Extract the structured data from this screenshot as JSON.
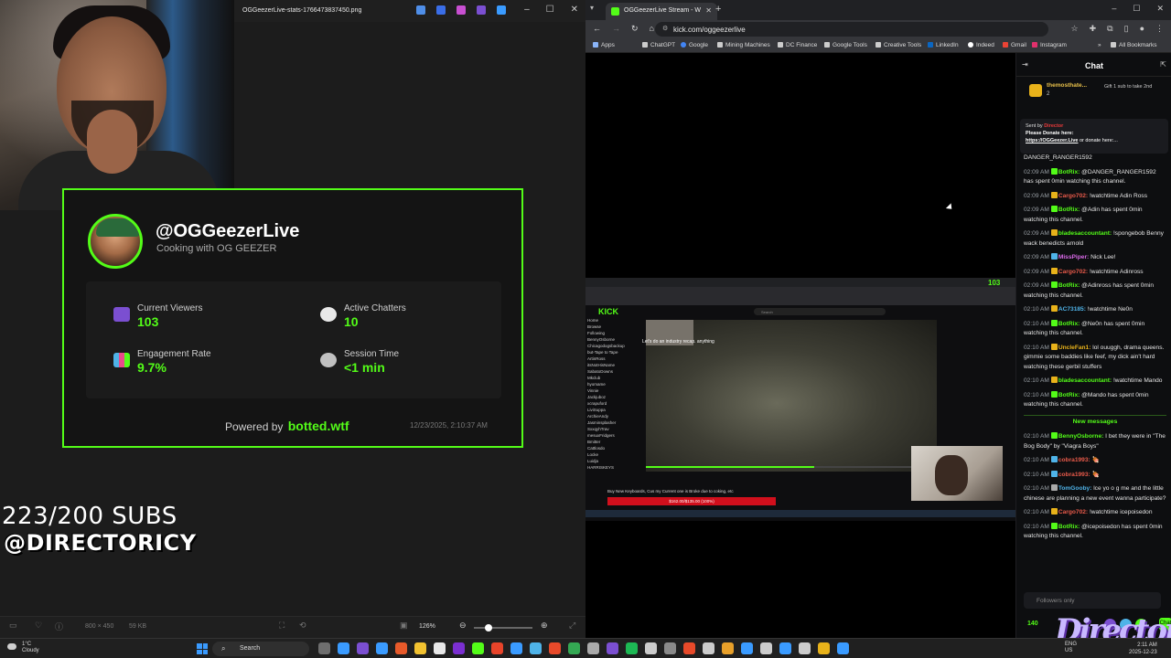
{
  "viewer": {
    "filename": "OGGeezerLive-stats-1766473837450.png",
    "minimize": "–",
    "maximize": "☐",
    "close": "✕",
    "bottom": {
      "dimensions": "800 × 450",
      "filesize": "59 KB",
      "zoom": "126%",
      "zoom_out": "⊖",
      "zoom_in": "⊕"
    }
  },
  "stats_card": {
    "handle": "@OGGeezerLive",
    "tagline": "Cooking with OG GEEZER",
    "stats": [
      {
        "label": "Current Viewers",
        "value": "103",
        "icon": "people-icon",
        "color": "#7b4fd1"
      },
      {
        "label": "Active Chatters",
        "value": "10",
        "icon": "speech-bubble-icon",
        "color": "#e8e8e8"
      },
      {
        "label": "Engagement Rate",
        "value": "9.7%",
        "icon": "bar-chart-icon",
        "color": "#4fb3e8"
      },
      {
        "label": "Session Time",
        "value": "<1 min",
        "icon": "stopwatch-icon",
        "color": "#c0c0c0"
      }
    ],
    "powered_prefix": "Powered by",
    "powered_brand": "botted.wtf",
    "timestamp": "12/23/2025, 2:10:37 AM"
  },
  "overlay": {
    "subs": "223/200 SUBS",
    "handle": "@DIRECTORICY"
  },
  "browser": {
    "tab_title": "OGGeezerLive Stream - W",
    "url": "kick.com/oggeezerlive",
    "new_tab": "+",
    "bookmarks": [
      {
        "label": "Apps",
        "color": "#8ab4f8"
      },
      {
        "label": "ChatGPT",
        "color": "#cccccc"
      },
      {
        "label": "Google",
        "color": "#4285f4"
      },
      {
        "label": "Mining Machines",
        "color": "#cccccc"
      },
      {
        "label": "DC Finance",
        "color": "#cccccc"
      },
      {
        "label": "Google Tools",
        "color": "#cccccc"
      },
      {
        "label": "Creative Tools",
        "color": "#cccccc"
      },
      {
        "label": "LinkedIn",
        "color": "#0a66c2"
      },
      {
        "label": "Indeed",
        "color": "#ffffff"
      },
      {
        "label": "Gmail",
        "color": "#ea4335"
      },
      {
        "label": "Instagram",
        "color": "#e1306c"
      }
    ],
    "all_bookmarks": "All Bookmarks"
  },
  "stream": {
    "kick_logo": "KICK",
    "search": "Search",
    "caption": "Let's do an industry recap. anything",
    "donation_bar": "$162.00/$135.00 (100%)",
    "donation_note": "Buy New Keyboards, Cus my Current one is Broke due to coking, etc",
    "viewers_badge": "103",
    "progress": 0.58,
    "sidebar": [
      "Home",
      "Browse",
      "Following",
      "BennyOsborne",
      "Chicagodogsbackup",
      "but-Tape to Tape",
      "ArtinRoss",
      "itsNotHisName",
      "SabatoDowns",
      "Mkclub",
      "hyomame",
      "Vinnie",
      "Jackjuboz",
      "xcrapuford",
      "LiviSuppa",
      "ArchieAndy",
      "Jasminsplasher",
      "SxxqyhTrav",
      "mesuxFridgers",
      "Bmitter",
      "Cattlosdo",
      "Locke",
      "Luidja",
      "HARRISKEYS"
    ]
  },
  "chat": {
    "title": "Chat",
    "gift_user": "themosthate...",
    "gift_count": "2",
    "gift_cta": "Gift 1 sub to take 2nd",
    "pinned_sentby_prefix": "Sent by",
    "pinned_sentby_user": "Director",
    "pinned_donate": "Please Donate here:",
    "pinned_link": "https://OGGeezer.Live",
    "pinned_rest": "or donate here:...",
    "new_messages": "New messages",
    "messages": [
      {
        "time": "",
        "user": "",
        "ucolor": "#e8e8e8",
        "badge": "",
        "text": "DANGER_RANGER1592"
      },
      {
        "time": "02:09 AM",
        "user": "BotRix:",
        "ucolor": "#53fc18",
        "badge": "#53fc18",
        "text": "@DANGER_RANGER1592 has spent 0min watching this channel."
      },
      {
        "time": "02:09 AM",
        "user": "Cargo702:",
        "ucolor": "#e85a4a",
        "badge": "#e8b21a",
        "text": "!watchtime Adin Ross"
      },
      {
        "time": "02:09 AM",
        "user": "BotRix:",
        "ucolor": "#53fc18",
        "badge": "#53fc18",
        "text": "@Adin has spent 0min watching this channel."
      },
      {
        "time": "02:09 AM",
        "user": "bladesaccountant:",
        "ucolor": "#53fc18",
        "badge": "#e8b21a",
        "text": "!spongebob Benny wack benedicts arnold"
      },
      {
        "time": "02:09 AM",
        "user": "MissPiper:",
        "ucolor": "#d96ae8",
        "badge": "#4fb3e8",
        "text": "Nick Lee!"
      },
      {
        "time": "02:09 AM",
        "user": "Cargo702:",
        "ucolor": "#e85a4a",
        "badge": "#e8b21a",
        "text": "!watchtime Adinross"
      },
      {
        "time": "02:09 AM",
        "user": "BotRix:",
        "ucolor": "#53fc18",
        "badge": "#53fc18",
        "text": "@Adinross has spent 0min watching this channel."
      },
      {
        "time": "02:10 AM",
        "user": "AC73185:",
        "ucolor": "#4fb3e8",
        "badge": "#e8b21a",
        "text": "!watchtime Ne0n"
      },
      {
        "time": "02:10 AM",
        "user": "BotRix:",
        "ucolor": "#53fc18",
        "badge": "#53fc18",
        "text": "@Ne0n has spent 0min watching this channel."
      },
      {
        "time": "02:10 AM",
        "user": "UncleFan1:",
        "ucolor": "#e8b21a",
        "badge": "#e8b21a",
        "text": "lol ouuggh, drama queens. gimmie some baddies like feef, my dick ain't hard watching these gerbil stuffers"
      },
      {
        "time": "02:10 AM",
        "user": "bladesaccountant:",
        "ucolor": "#53fc18",
        "badge": "#e8b21a",
        "text": "!watchtime Mando"
      },
      {
        "time": "02:10 AM",
        "user": "BotRix:",
        "ucolor": "#53fc18",
        "badge": "#53fc18",
        "text": "@Mando has spent 0min watching this channel."
      }
    ],
    "messages_after": [
      {
        "time": "02:10 AM",
        "user": "BennyOsborne:",
        "ucolor": "#53fc18",
        "badge": "#53fc18",
        "text": "I bet they were in \"The Bog Body\" by \"Viagra Boys\""
      },
      {
        "time": "02:10 AM",
        "user": "cobra1993:",
        "ucolor": "#e85a4a",
        "badge": "#4fb3e8",
        "text": "🍖"
      },
      {
        "time": "02:10 AM",
        "user": "cobra1993:",
        "ucolor": "#e85a4a",
        "badge": "#4fb3e8",
        "text": "🍖"
      },
      {
        "time": "02:10 AM",
        "user": "TomGooby:",
        "ucolor": "#4fb3e8",
        "badge": "#aaaaaa",
        "text": "lce yo o g me and the little chinese are planning a new event wanna participate?"
      },
      {
        "time": "02:10 AM",
        "user": "Cargo702:",
        "ucolor": "#e85a4a",
        "badge": "#e8b21a",
        "text": "!watchtime icepoisedon"
      },
      {
        "time": "02:10 AM",
        "user": "BotRix:",
        "ucolor": "#53fc18",
        "badge": "#53fc18",
        "text": "@icepoisedon has spent 0min watching this channel."
      }
    ],
    "input_placeholder": "Followers only",
    "points": "140",
    "zero": "0",
    "chat_button": "Chat"
  },
  "watermark": "DirectorICY",
  "taskbar": {
    "temp": "1°C",
    "condition": "Cloudy",
    "search": "Search",
    "lang": "ENG",
    "region": "US",
    "time": "2:11 AM",
    "date": "2025-12-23",
    "apps": [
      "#6e6e6e",
      "#3a9bff",
      "#7b4fd1",
      "#3a9bff",
      "#e85a2a",
      "#f2c230",
      "#e8e8e8",
      "#7b2fd1",
      "#53fc18",
      "#e8442a",
      "#3a9bff",
      "#4fb3e8",
      "#e84a2a",
      "#34a853",
      "#aaaaaa",
      "#7b4fd1",
      "#1db954",
      "#cccccc",
      "#8a8a8a",
      "#e84a2a",
      "#cccccc",
      "#e8a02a",
      "#3a9bff",
      "#cccccc",
      "#3a9bff",
      "#cccccc",
      "#e8b21a",
      "#3a9bff"
    ]
  }
}
